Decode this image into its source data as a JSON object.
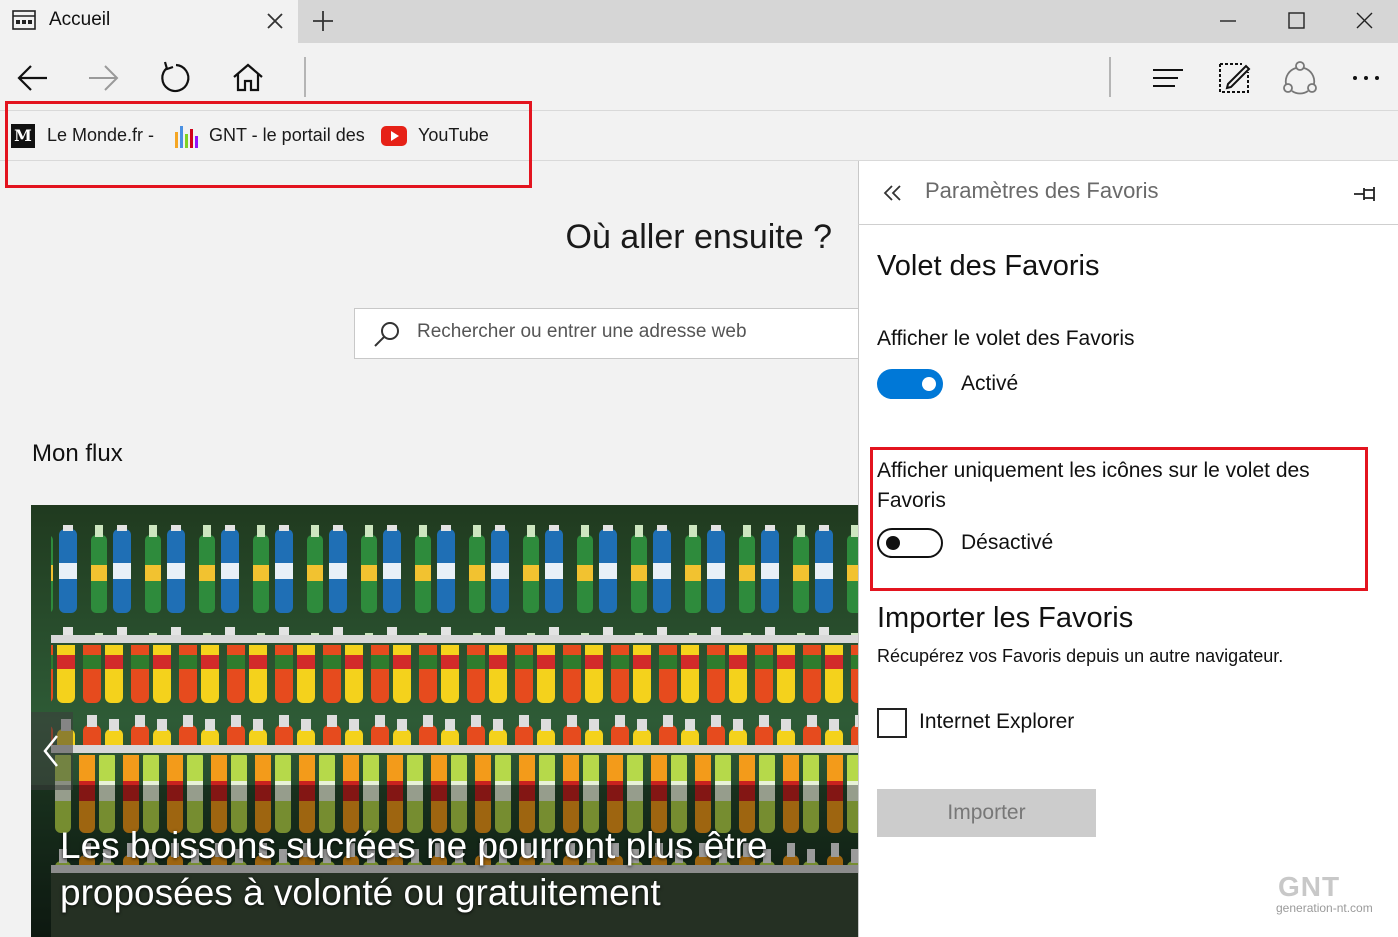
{
  "tab": {
    "title": "Accueil",
    "icon": "page-icon"
  },
  "window_controls": {
    "minimize": "minimize-icon",
    "maximize": "maximize-icon",
    "close": "close-icon"
  },
  "favorites_bar": {
    "items": [
      {
        "label": "Le Monde.fr -",
        "icon": "lemonde-icon"
      },
      {
        "label": "GNT - le portail des",
        "icon": "gnt-icon"
      },
      {
        "label": "YouTube",
        "icon": "youtube-icon"
      }
    ]
  },
  "newtab": {
    "heading": "Où aller ensuite ?",
    "search_placeholder": "Rechercher ou entrer une adresse web",
    "feed_title": "Mon flux",
    "headline": "Les boissons sucrées ne pourront plus être proposées à volonté ou gratuitement"
  },
  "panel": {
    "title": "Paramètres des Favoris",
    "favorites_bar_section": {
      "title": "Volet des Favoris",
      "show_bar_label": "Afficher le volet des Favoris",
      "show_bar_state": "Activé",
      "show_bar_on": true,
      "icons_only_label": "Afficher uniquement les icônes sur le volet des Favoris",
      "icons_only_state": "Désactivé",
      "icons_only_on": false
    },
    "import_section": {
      "title": "Importer les Favoris",
      "description": "Récupérez vos Favoris depuis un autre navigateur.",
      "browser_option": "Internet Explorer",
      "browser_checked": false,
      "import_button": "Importer"
    }
  },
  "watermark": {
    "logo": "GNT",
    "url": "generation-nt.com"
  },
  "colors": {
    "accent": "#0078d7",
    "highlight": "#e3141f",
    "youtube": "#e62117"
  }
}
